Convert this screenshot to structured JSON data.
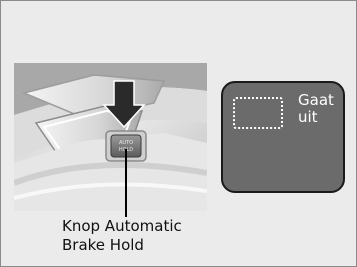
{
  "indicator": {
    "label": "Gaat\nuit"
  },
  "callout": {
    "label": "Knop Automatic\nBrake Hold"
  },
  "button_engraving": "AUTO\nHOLD"
}
